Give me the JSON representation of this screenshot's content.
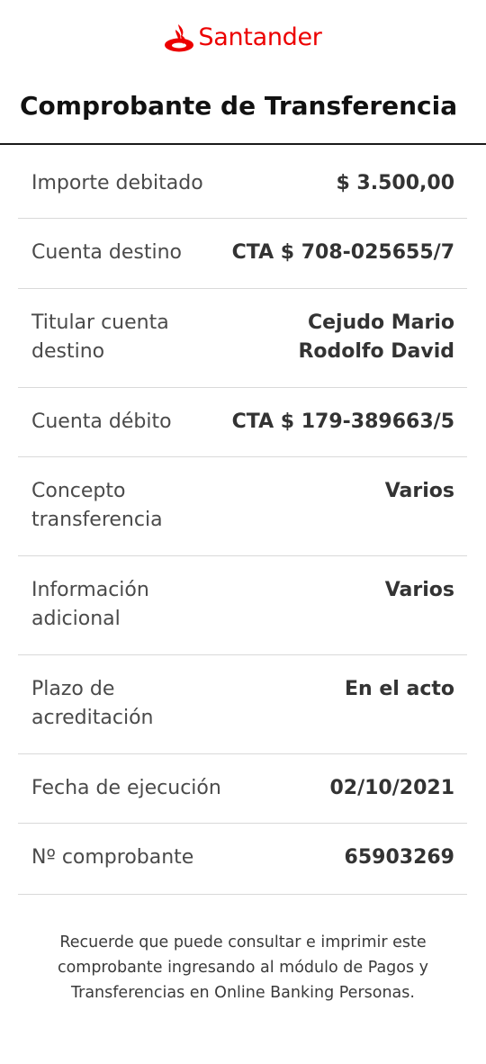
{
  "brand": {
    "name": "Santander",
    "color": "#ec0000",
    "icon": "santander-flame-icon"
  },
  "page": {
    "title": "Comprobante de Transferencia"
  },
  "details": [
    {
      "label": "Importe debitado",
      "value": "$ 3.500,00"
    },
    {
      "label": "Cuenta destino",
      "value": "CTA $ 708-025655/7"
    },
    {
      "label": "Titular cuenta destino",
      "value": "Cejudo Mario Rodolfo David"
    },
    {
      "label": "Cuenta débito",
      "value": "CTA $ 179-389663/5"
    },
    {
      "label": "Concepto transferencia",
      "value": "Varios"
    },
    {
      "label": "Información adicional",
      "value": "Varios"
    },
    {
      "label": "Plazo de acreditación",
      "value": "En el acto"
    },
    {
      "label": "Fecha de ejecución",
      "value": "02/10/2021"
    },
    {
      "label": "Nº comprobante",
      "value": "65903269"
    }
  ],
  "footnote": "Recuerde que puede consultar e imprimir este comprobante ingresando al módulo de Pagos y Transferencias en Online Banking Personas."
}
